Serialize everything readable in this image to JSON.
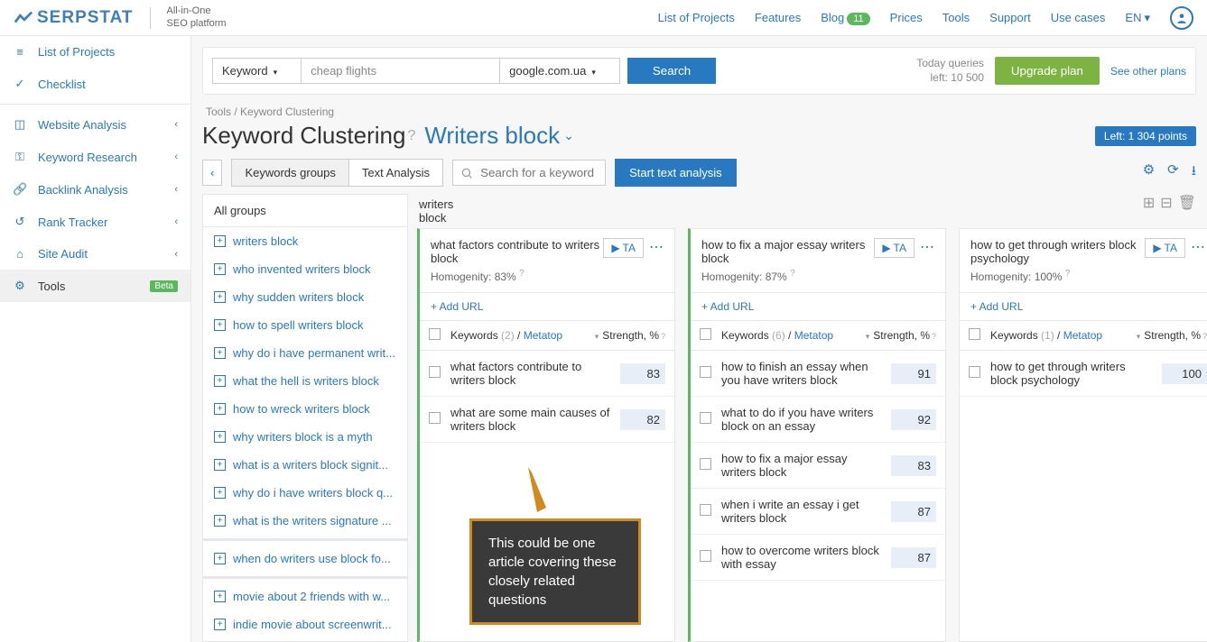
{
  "header": {
    "logo": "SERPSTAT",
    "tagline_l1": "All-in-One",
    "tagline_l2": "SEO platform",
    "nav": {
      "projects": "List of Projects",
      "features": "Features",
      "blog": "Blog",
      "blog_badge": "11",
      "prices": "Prices",
      "tools": "Tools",
      "support": "Support",
      "use_cases": "Use cases",
      "lang": "EN"
    }
  },
  "sidebar": {
    "items": [
      {
        "label": "List of Projects",
        "icon": "≡"
      },
      {
        "label": "Checklist",
        "icon": "✓"
      },
      {
        "label": "Website Analysis",
        "icon": "◫",
        "chev": true
      },
      {
        "label": "Keyword Research",
        "icon": "⚿",
        "chev": true
      },
      {
        "label": "Backlink Analysis",
        "icon": "🔗",
        "chev": true
      },
      {
        "label": "Rank Tracker",
        "icon": "↺",
        "chev": true
      },
      {
        "label": "Site Audit",
        "icon": "⌂",
        "chev": true
      },
      {
        "label": "Tools",
        "icon": "⚙",
        "beta": "Beta",
        "active": true
      }
    ]
  },
  "toolbar": {
    "type": "Keyword",
    "input_placeholder": "cheap flights",
    "engine": "google.com.ua",
    "search": "Search",
    "queries_l1": "Today queries",
    "queries_l2": "left: 10 500",
    "upgrade": "Upgrade plan",
    "see_plans": "See other plans"
  },
  "breadcrumb": "Tools / Keyword Clustering",
  "page_title": "Keyword Clustering",
  "project": "Writers block",
  "points_badge": "Left: 1 304 points",
  "tabs": {
    "kw_groups": "Keywords groups",
    "text_analysis": "Text Analysis"
  },
  "kw_search_placeholder": "Search for a keyword",
  "start_btn": "Start text analysis",
  "groups_header": "All groups",
  "groups": {
    "main": [
      "writers block",
      "who invented writers block",
      "why sudden writers block",
      "how to spell writers block",
      "why do i have permanent writ...",
      "what the hell is writers block",
      "how to wreck writers block",
      "why writers block is a myth",
      "what is a writers block signit...",
      "why do i have writers block q...",
      "what is the writers signature ..."
    ],
    "sep1": [
      "when do writers use block fo..."
    ],
    "sep2": [
      "movie about 2 friends with w...",
      "indie movie about screenwrit..."
    ]
  },
  "cluster_top_l1": "writers",
  "cluster_top_l2": "block",
  "col_kw_label": "Keywords",
  "col_metatop": "Metatop",
  "col_strength": "Strength, %",
  "add_url": "+ Add URL",
  "homog_label": "Homogenity:",
  "ta_label": "TA",
  "clusters": [
    {
      "title": "what factors contribute to writers block",
      "homog": "83%",
      "count": "(2)",
      "rows": [
        {
          "kw": "what factors contribute to writers block",
          "str": "83"
        },
        {
          "kw": "what are some main causes of writers block",
          "str": "82"
        }
      ]
    },
    {
      "title": "how to fix a major essay writers block",
      "homog": "87%",
      "count": "(6)",
      "rows": [
        {
          "kw": "how to finish an essay when you have writers block",
          "str": "91"
        },
        {
          "kw": "what to do if you have writers block on an essay",
          "str": "92"
        },
        {
          "kw": "how to fix a major essay writers block",
          "str": "83"
        },
        {
          "kw": "when i write an essay i get writers block",
          "str": "87"
        },
        {
          "kw": "how to overcome writers block with essay",
          "str": "87"
        }
      ]
    },
    {
      "title": "how to get through writers block psychology",
      "homog": "100%",
      "count": "(1)",
      "rows": [
        {
          "kw": "how to get through writers block psychology",
          "str": "100"
        }
      ]
    }
  ],
  "callout": "This could be one article covering these closely related questions"
}
